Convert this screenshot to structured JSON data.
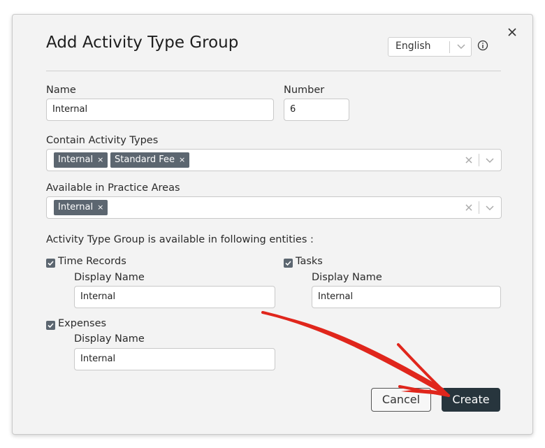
{
  "dialog": {
    "title": "Add Activity Type Group",
    "language": "English"
  },
  "form": {
    "name_label": "Name",
    "name_value": "Internal",
    "number_label": "Number",
    "number_value": "6",
    "activity_types_label": "Contain Activity Types",
    "activity_types": [
      "Internal",
      "Standard Fee"
    ],
    "practice_areas_label": "Available in Practice Areas",
    "practice_areas": [
      "Internal"
    ],
    "entities_label": "Activity Type Group is available in following entities :",
    "time_records": {
      "label": "Time Records",
      "display_name_label": "Display Name",
      "display_name": "Internal",
      "checked": true
    },
    "tasks": {
      "label": "Tasks",
      "display_name_label": "Display Name",
      "display_name": "Internal",
      "checked": true
    },
    "expenses": {
      "label": "Expenses",
      "display_name_label": "Display Name",
      "display_name": "Internal",
      "checked": true
    }
  },
  "buttons": {
    "cancel": "Cancel",
    "create": "Create"
  },
  "icons": {
    "close": "close-icon",
    "info": "info-icon",
    "chevron": "chevron-down-icon",
    "clear": "clear-icon",
    "tag_remove": "×"
  },
  "colors": {
    "primary_button": "#27353d",
    "tag_bg": "#5c6670",
    "annotation_arrow": "#e0261c"
  }
}
